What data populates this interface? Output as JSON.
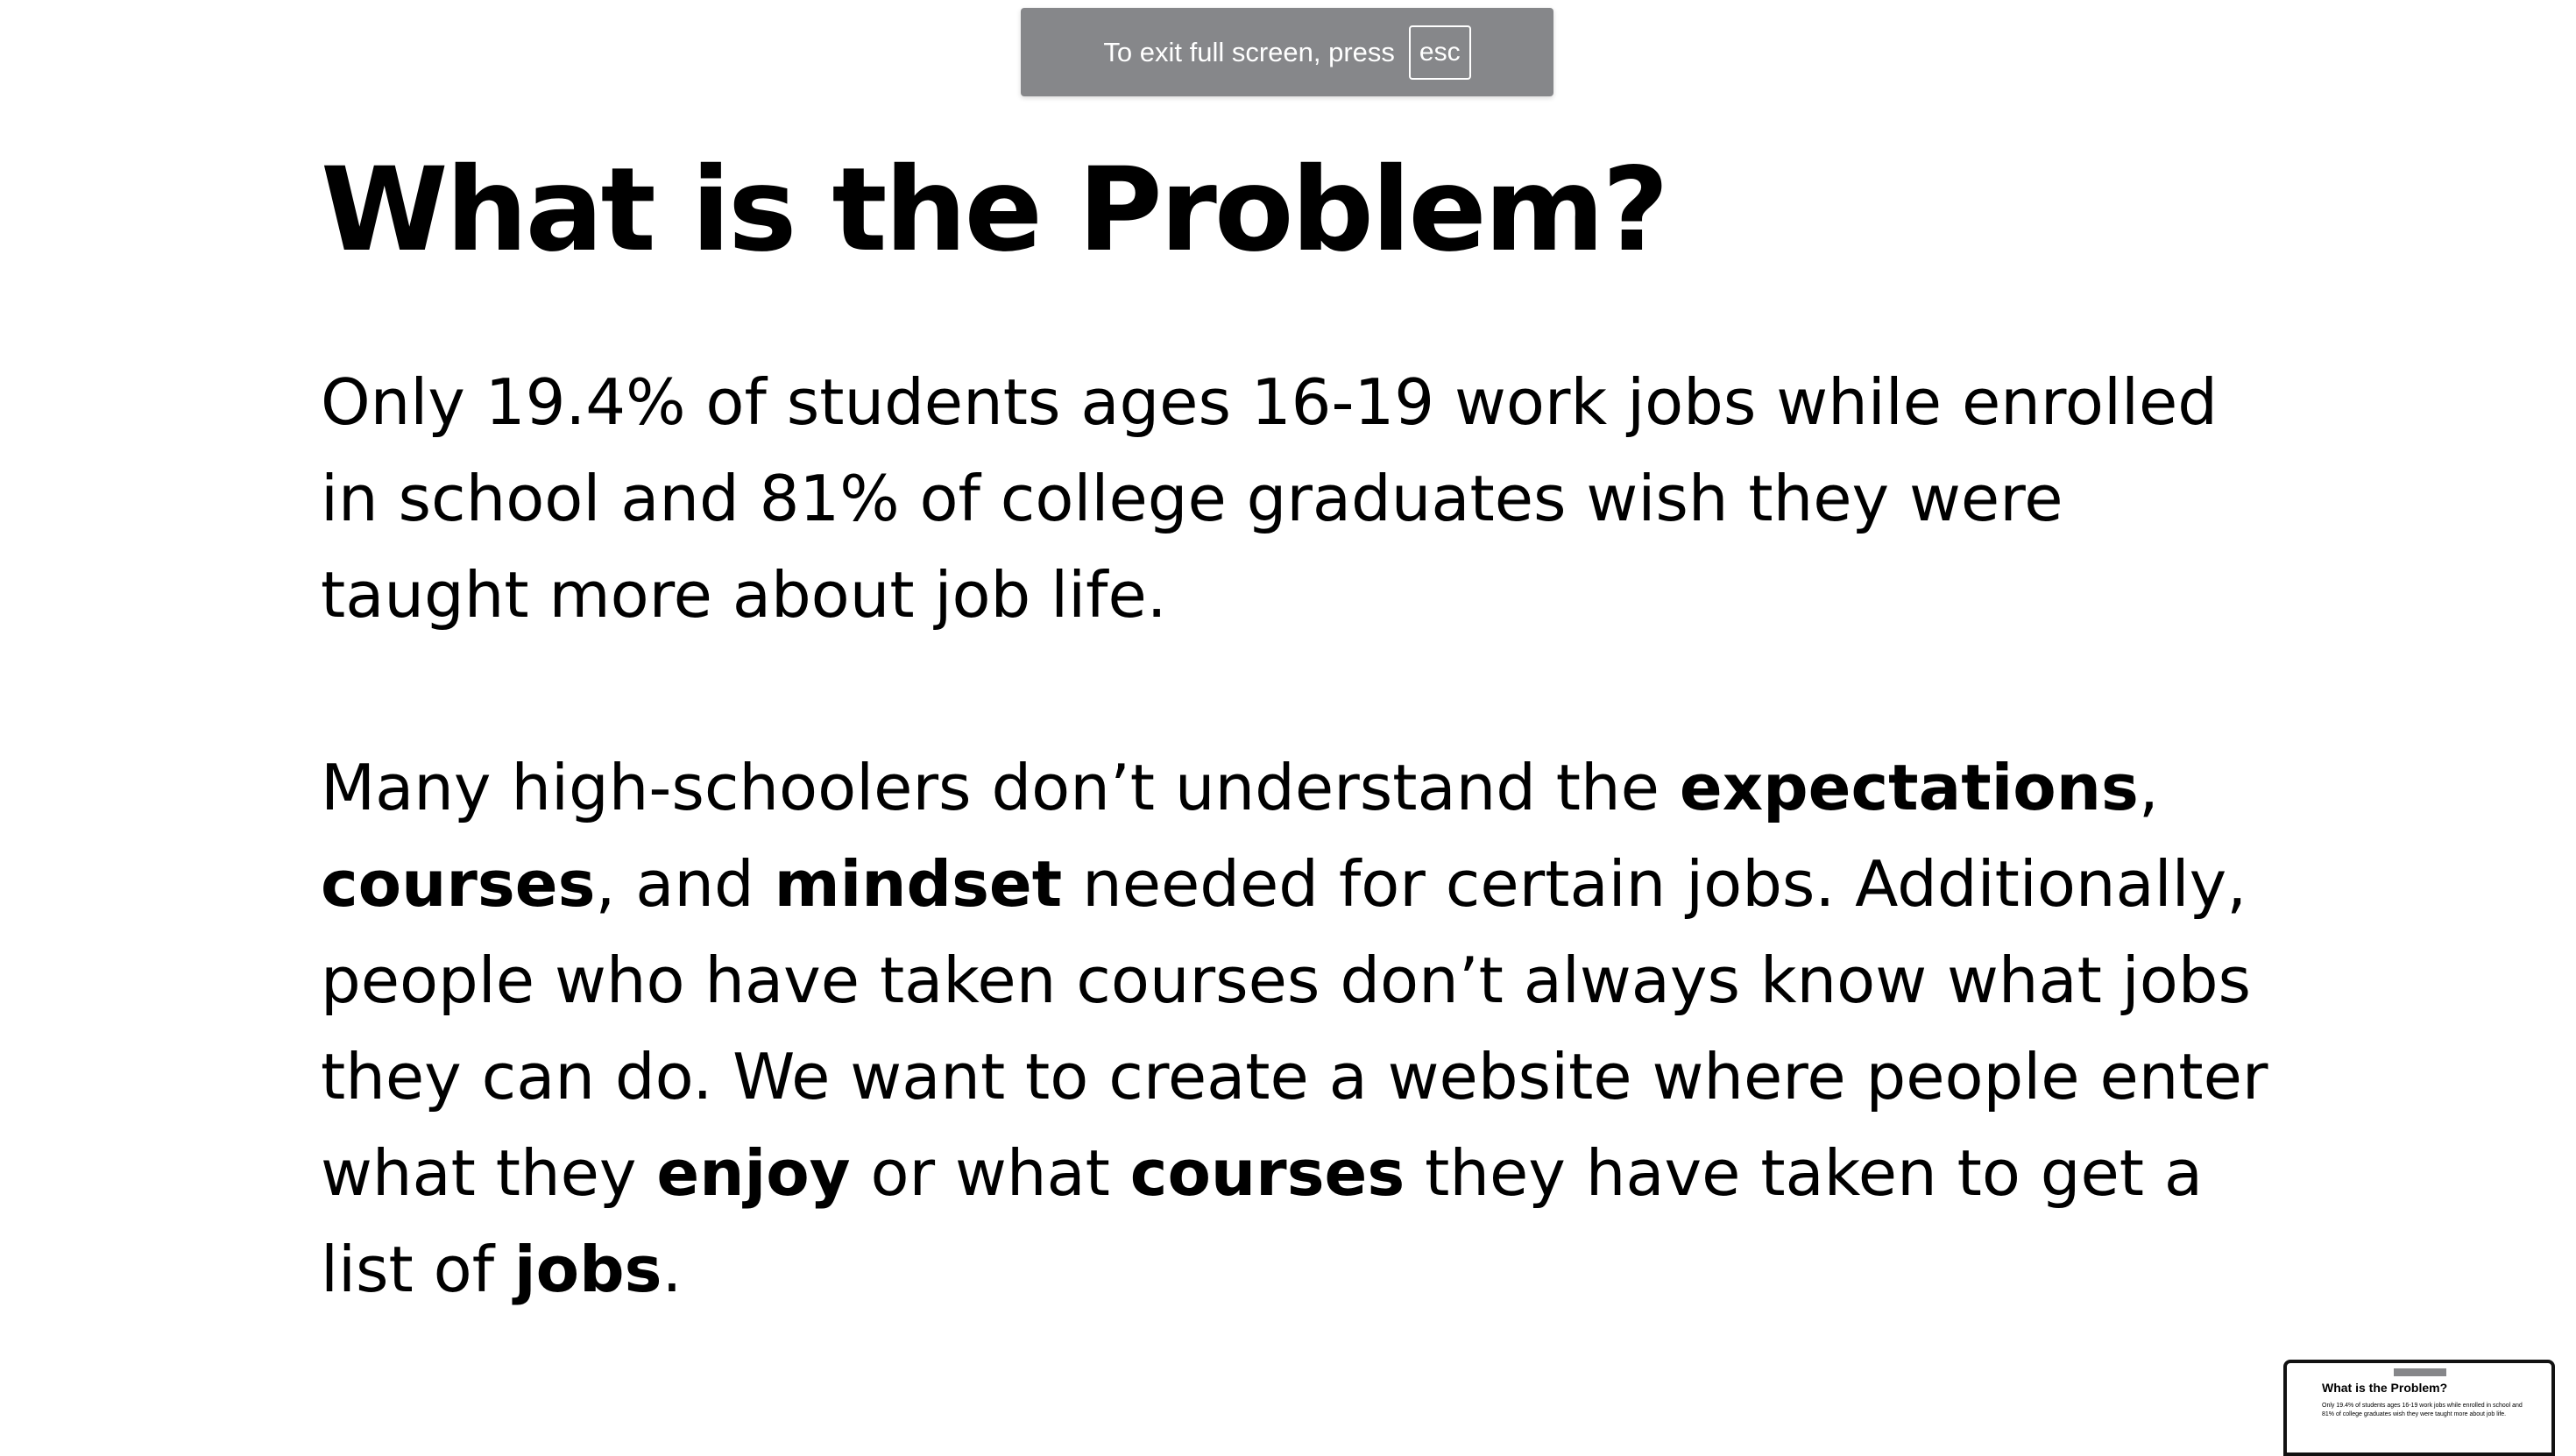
{
  "fullscreen_notice": {
    "text": "To exit full screen, press",
    "key": "esc"
  },
  "slide": {
    "title": "What is the Problem?",
    "paragraph1": "Only 19.4% of students ages 16-19 work jobs while enrolled in school and 81% of college graduates wish they were taught more about job life.",
    "paragraph2": {
      "t1": "Many high-schoolers don’t understand the ",
      "b1": "expectations",
      "t2": ", ",
      "b2": "courses",
      "t3": ", and ",
      "b3": "mindset",
      "t4": " needed for certain jobs. Additionally, people who have taken courses don’t always know what jobs they can do. We want to create a website where people enter what they ",
      "b4": "enjoy",
      "t5": " or what ",
      "b5": "courses",
      "t6": " they have taken to get a list of ",
      "b6": "jobs",
      "t7": "."
    }
  },
  "thumbnail": {
    "title": "What is the Problem?",
    "text": "Only 19.4% of students ages 16-19 work jobs while enrolled in school and 81% of college graduates wish they were taught more about job life."
  }
}
